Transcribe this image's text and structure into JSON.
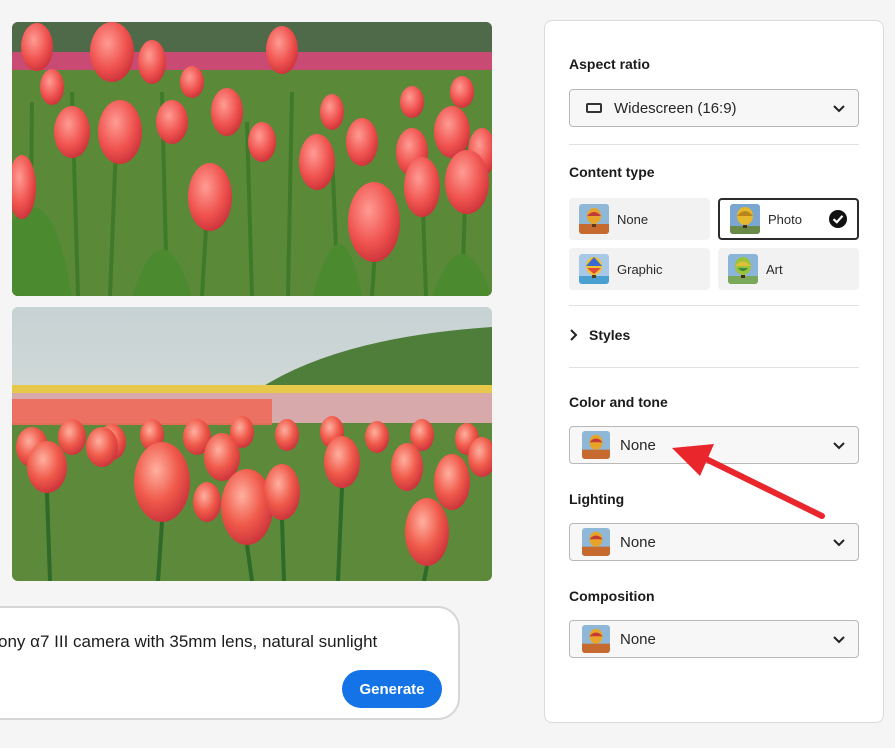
{
  "images": [
    {
      "alt_name": "tulip-field-image-1"
    },
    {
      "alt_name": "tulip-field-image-2"
    }
  ],
  "prompt": {
    "text": "ony α7 III camera with 35mm lens, natural sunlight",
    "generate_label": "Generate"
  },
  "panel": {
    "aspect_ratio": {
      "title": "Aspect ratio",
      "value": "Widescreen (16:9)",
      "icon": "widescreen-icon"
    },
    "content_type": {
      "title": "Content type",
      "options": [
        {
          "label": "None",
          "icon": "balloon-thumb",
          "selected": false
        },
        {
          "label": "Photo",
          "icon": "balloon-thumb",
          "selected": true
        },
        {
          "label": "Graphic",
          "icon": "balloon-thumb",
          "selected": false
        },
        {
          "label": "Art",
          "icon": "balloon-thumb",
          "selected": false
        }
      ]
    },
    "styles": {
      "label": "Styles",
      "icon": "chevron-right-icon"
    },
    "color_and_tone": {
      "title": "Color and tone",
      "value": "None"
    },
    "lighting": {
      "title": "Lighting",
      "value": "None"
    },
    "composition": {
      "title": "Composition",
      "value": "None"
    }
  },
  "colors": {
    "accent": "#1473e6",
    "annotation_arrow": "#e8262b"
  }
}
